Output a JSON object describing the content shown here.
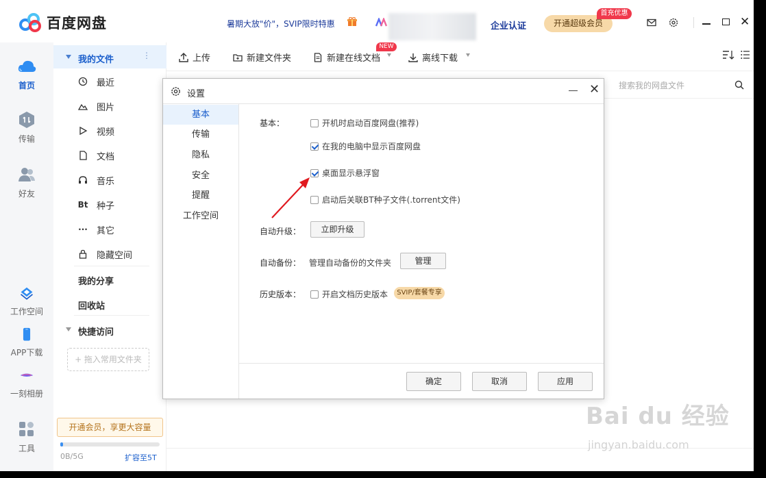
{
  "app": {
    "name": "百度网盘"
  },
  "title_bar": {
    "promo": "暑期大放\"价\"，SVIP限时特惠",
    "enterprise": "企业认证",
    "vip_button": "开通超级会员",
    "vip_badge": "首充优惠"
  },
  "rail": [
    {
      "label": "首页",
      "icon": "cloud-icon",
      "active": true
    },
    {
      "label": "传输",
      "icon": "transfer-icon"
    },
    {
      "label": "好友",
      "icon": "friends-icon"
    },
    {
      "label": "工作空间",
      "icon": "workspace-icon"
    },
    {
      "label": "APP下载",
      "icon": "phone-icon"
    },
    {
      "label": "一刻相册",
      "icon": "album-icon"
    },
    {
      "label": "工具",
      "icon": "tools-icon"
    }
  ],
  "nav": {
    "my_files": "我的文件",
    "items": [
      {
        "label": "最近",
        "icon": "clock-icon"
      },
      {
        "label": "图片",
        "icon": "picture-icon"
      },
      {
        "label": "视频",
        "icon": "play-icon"
      },
      {
        "label": "文档",
        "icon": "document-icon"
      },
      {
        "label": "音乐",
        "icon": "headphones-icon"
      },
      {
        "label": "种子",
        "icon": "bt-icon",
        "glyph": "Bt"
      },
      {
        "label": "其它",
        "icon": "more-icon",
        "glyph": "···"
      },
      {
        "label": "隐藏空间",
        "icon": "lock-icon"
      }
    ],
    "my_share": "我的分享",
    "recycle": "回收站",
    "quick_access": "快捷访问",
    "drop_hint": "+ 拖入常用文件夹",
    "member_promo": "开通会员，享更大容量",
    "storage": "0B/5G",
    "expand": "扩容至5T"
  },
  "toolbar": {
    "upload": "上传",
    "new_folder": "新建文件夹",
    "new_online_doc": "新建在线文档",
    "new_badge": "NEW",
    "offline_download": "离线下载",
    "search_placeholder": "搜索我的网盘文件"
  },
  "dialog": {
    "title": "设置",
    "tabs": [
      "基本",
      "传输",
      "隐私",
      "安全",
      "提醒",
      "工作空间"
    ],
    "active_tab": 0,
    "basic_label": "基本：",
    "options": [
      {
        "label": "开机时启动百度网盘(推荐)",
        "checked": false
      },
      {
        "label": "在我的电脑中显示百度网盘",
        "checked": true
      },
      {
        "label": "桌面显示悬浮窗",
        "checked": true
      },
      {
        "label": "启动后关联BT种子文件(.torrent文件)",
        "checked": false
      }
    ],
    "auto_upgrade_label": "自动升级：",
    "upgrade_button": "立即升级",
    "auto_backup_label": "自动备份：",
    "backup_text": "管理自动备份的文件夹",
    "manage_button": "管理",
    "history_label": "历史版本：",
    "history_option": "开启文档历史版本",
    "history_checked": false,
    "svip_tag": "SVIP/套餐专享",
    "ok": "确定",
    "cancel": "取消",
    "apply": "应用"
  },
  "watermark": {
    "main": "Bai du 经验",
    "sub": "jingyan.baidu.com"
  },
  "colors": {
    "accent": "#1b5fcc",
    "arrow": "#e0191f",
    "vip_gold": "#f7d9a8",
    "badge_red": "#f0384b"
  }
}
